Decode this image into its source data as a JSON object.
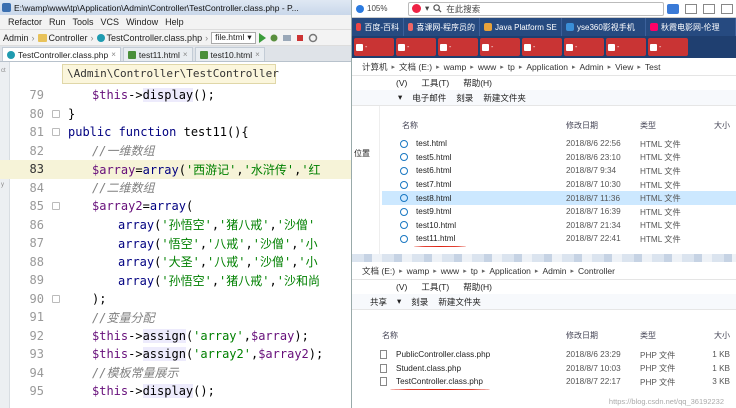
{
  "ide": {
    "title": "E:\\wamp\\www\\tp\\Application\\Admin\\Controller\\TestController.class.php - P...",
    "menu": [
      "Refactor",
      "Run",
      "Tools",
      "VCS",
      "Window",
      "Help"
    ],
    "nav": {
      "crumb1": "Admin",
      "crumb2": "Controller",
      "crumb3": "TestController.class.php",
      "dropdown": "file.html"
    },
    "tabs": [
      "TestController.class.php",
      "test11.html",
      "test10.html"
    ],
    "breadcrumb": "\\Admin\\Controller\\TestController",
    "strip_labels": [
      "ct",
      "y"
    ],
    "lines": [
      {
        "num": "79",
        "code": "$this->display();"
      },
      {
        "num": "80",
        "code": "}"
      },
      {
        "num": "81",
        "code": "public function test11(){"
      },
      {
        "num": "82",
        "code": "//一维数组"
      },
      {
        "num": "83",
        "code": "$array=array('西游记','水浒传','红"
      },
      {
        "num": "84",
        "code": "//二维数组"
      },
      {
        "num": "85",
        "code": "$array2=array("
      },
      {
        "num": "86",
        "code": "array('孙悟空','猪八戒','沙僧'"
      },
      {
        "num": "87",
        "code": "array('悟空','八戒','沙僧','小"
      },
      {
        "num": "88",
        "code": "array('大圣','八戒','沙僧','小"
      },
      {
        "num": "89",
        "code": "array('孙悟空','猪八戒','沙和尚"
      },
      {
        "num": "90",
        "code": ");"
      },
      {
        "num": "91",
        "code": "//变量分配"
      },
      {
        "num": "92",
        "code": "$this->assign('array',$array);"
      },
      {
        "num": "93",
        "code": "$this->assign('array2',$array2);"
      },
      {
        "num": "94",
        "code": "//模板常量展示"
      },
      {
        "num": "95",
        "code": "$this->display();"
      }
    ]
  },
  "browser": {
    "zoom": "105%",
    "search": "在此搜索",
    "tabs": [
      "百度-百科",
      "喜课网-程序员的",
      "Java Platform SE",
      "yse360影视手机",
      "秋霞电影网-伦理"
    ],
    "mini_tabs": [
      "-",
      "-",
      "-",
      "-",
      "-",
      "-",
      "-",
      "-"
    ]
  },
  "explorer1": {
    "address": [
      "计算机",
      "文档 (E:)",
      "wamp",
      "www",
      "tp",
      "Application",
      "Admin",
      "View",
      "Test"
    ],
    "ribbon": [
      "(V)",
      "工具(T)",
      "帮助(H)"
    ],
    "ribbon2": [
      "电子邮件",
      "刻录",
      "新建文件夹"
    ],
    "side": "位置",
    "headers": {
      "name": "名称",
      "date": "修改日期",
      "type": "类型",
      "size": "大小"
    },
    "files": [
      {
        "name": "test.html",
        "date": "2018/8/6 22:56",
        "type": "HTML 文件"
      },
      {
        "name": "test5.html",
        "date": "2018/8/6 23:10",
        "type": "HTML 文件"
      },
      {
        "name": "test6.html",
        "date": "2018/8/7 9:34",
        "type": "HTML 文件"
      },
      {
        "name": "test7.html",
        "date": "2018/8/7 10:30",
        "type": "HTML 文件"
      },
      {
        "name": "test8.html",
        "date": "2018/8/7 11:36",
        "type": "HTML 文件"
      },
      {
        "name": "test9.html",
        "date": "2018/8/7 16:39",
        "type": "HTML 文件"
      },
      {
        "name": "test10.html",
        "date": "2018/8/7 21:34",
        "type": "HTML 文件"
      },
      {
        "name": "test11.html",
        "date": "2018/8/7 22:41",
        "type": "HTML 文件"
      }
    ]
  },
  "explorer2": {
    "address": [
      "文档 (E:)",
      "wamp",
      "www",
      "tp",
      "Application",
      "Admin",
      "Controller"
    ],
    "ribbon": [
      "(V)",
      "工具(T)",
      "帮助(H)"
    ],
    "ribbon2": [
      "共享",
      "刻录",
      "新建文件夹"
    ],
    "headers": {
      "name": "名称",
      "date": "修改日期",
      "type": "类型",
      "size": "大小"
    },
    "files": [
      {
        "name": "PublicController.class.php",
        "date": "2018/8/6 23:29",
        "type": "PHP 文件",
        "size": "1 KB"
      },
      {
        "name": "Student.class.php",
        "date": "2018/8/7 10:03",
        "type": "PHP 文件",
        "size": "1 KB"
      },
      {
        "name": "TestController.class.php",
        "date": "2018/8/7 22:17",
        "type": "PHP 文件",
        "size": "3 KB"
      }
    ],
    "watermark": "https://blog.csdn.net/qq_36192232"
  }
}
